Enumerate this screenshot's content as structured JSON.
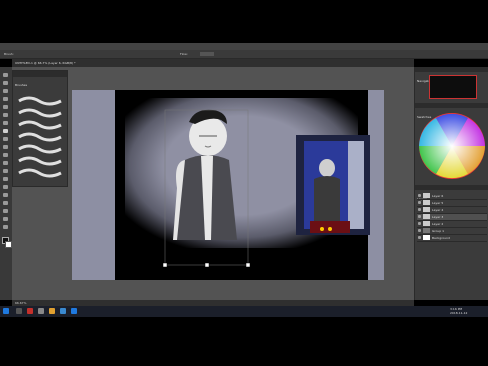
{
  "menu": [
    "File",
    "Edit",
    "Image",
    "Layer",
    "Type",
    "Select",
    "Filter",
    "3D",
    "View",
    "Window",
    "Help"
  ],
  "options": {
    "mode_label": "Brush:",
    "flow_label": "Flow:"
  },
  "doc_tab": {
    "title": "UNTITLED-1 @ 66.7% (Layer 6, RGB/8) *"
  },
  "brush_panel": {
    "title": "Brushes"
  },
  "right_panel": {
    "navigator": "Navigator",
    "swatches": "Swatches",
    "layers": "Layers"
  },
  "layers": [
    {
      "name": "Layer 6"
    },
    {
      "name": "Layer 5"
    },
    {
      "name": "Layer 4"
    },
    {
      "name": "Layer 3"
    },
    {
      "name": "Layer 2"
    },
    {
      "name": "Group 1"
    },
    {
      "name": "Background"
    }
  ],
  "status": {
    "zoom": "66.67%"
  },
  "clock": {
    "time": "3:16 PM",
    "date": "2018-11-12"
  },
  "colors": {
    "accent": "#1f7ae0",
    "doc_bg": "#8d8fa3"
  }
}
